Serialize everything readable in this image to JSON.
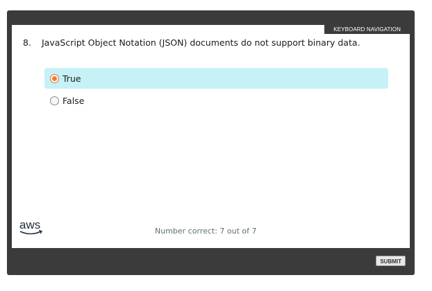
{
  "player": {
    "keyboard_nav_label": "KEYBOARD NAVIGATION",
    "submit_label": "SUBMIT"
  },
  "question": {
    "number": "8.",
    "text": "JavaScript Object Notation (JSON) documents do not support binary data."
  },
  "options": [
    {
      "label": "True",
      "selected": true
    },
    {
      "label": "False",
      "selected": false
    }
  ],
  "footer": {
    "logo_text": "aws",
    "score_text": "Number correct: 7 out of 7"
  },
  "colors": {
    "frame": "#3b3b3b",
    "selected_bg": "#c6f1f6",
    "radio_accent": "#f07a36",
    "aws_orange": "#ff9900",
    "aws_text": "#232f3e"
  }
}
